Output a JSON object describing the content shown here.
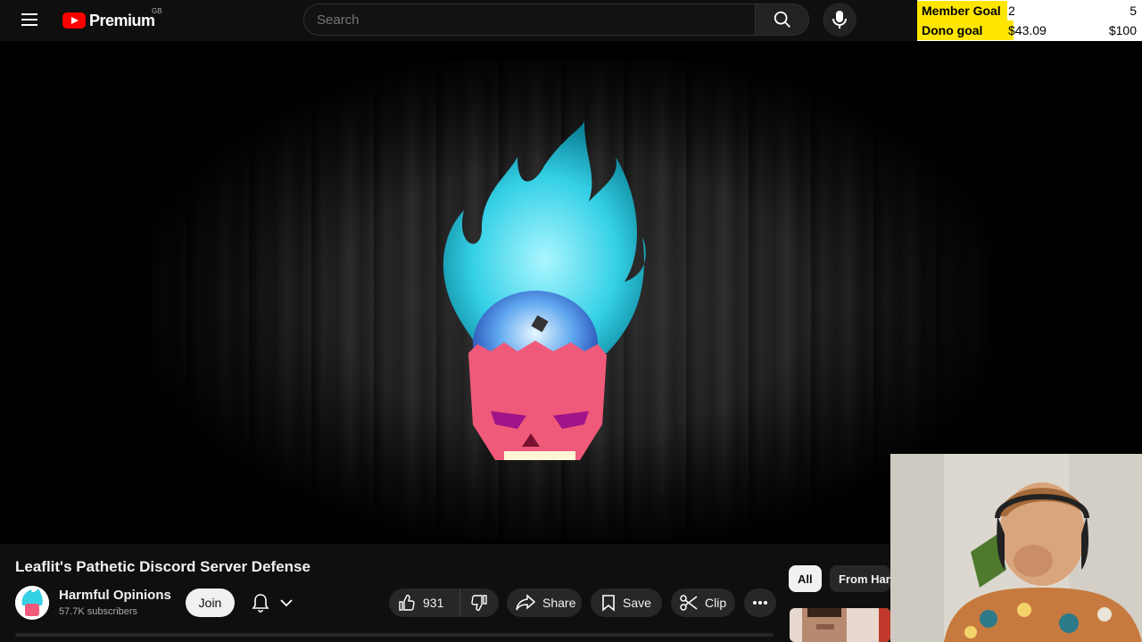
{
  "header": {
    "logo_text": "Premium",
    "region": "GB",
    "search_placeholder": "Search"
  },
  "overlay_goals": {
    "member_goal_label": "Member Goal",
    "member_goal_current": "2",
    "member_goal_target": "5",
    "member_goal_progress": 0.4,
    "dono_goal_label": "Dono goal",
    "dono_goal_current": "$43.09",
    "dono_goal_target": "$100",
    "dono_goal_progress": 0.43,
    "colors": {
      "fill": "#ffe600",
      "background": "#ffffff"
    }
  },
  "video": {
    "title": "Leaflit's Pathetic Discord Server Defense"
  },
  "channel": {
    "name": "Harmful Opinions",
    "subscribers": "57.7K subscribers",
    "join_label": "Join"
  },
  "actions": {
    "like_count": "931",
    "share_label": "Share",
    "save_label": "Save",
    "clip_label": "Clip"
  },
  "chips": {
    "all": "All",
    "from": "From Har"
  },
  "icons": [
    "menu-icon",
    "youtube-logo-icon",
    "search-icon",
    "mic-icon",
    "bell-icon",
    "chevron-down-icon",
    "thumbs-up-icon",
    "thumbs-down-icon",
    "share-icon",
    "bookmark-icon",
    "scissors-icon",
    "more-horizontal-icon"
  ]
}
